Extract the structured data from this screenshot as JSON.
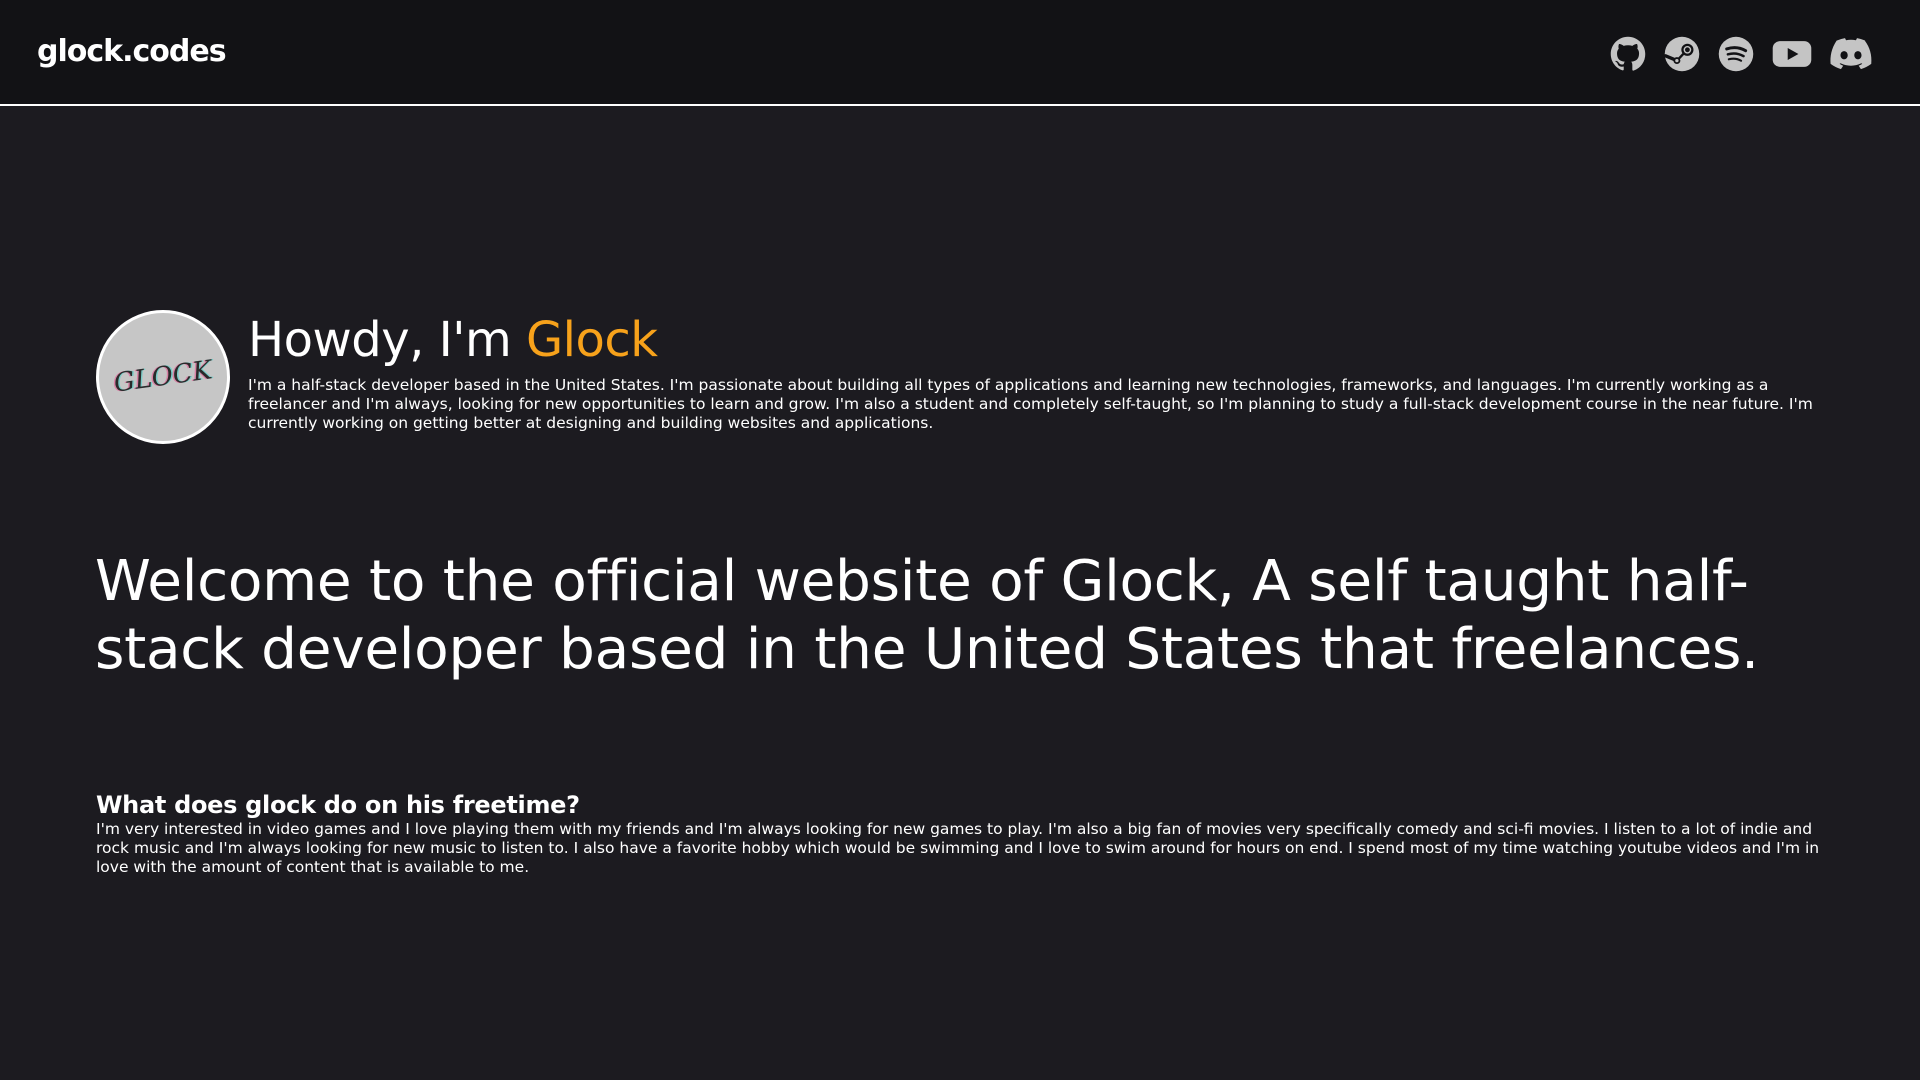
{
  "nav": {
    "brand": "glock.codes",
    "socials": [
      {
        "icon": "github-icon",
        "label": "GitHub"
      },
      {
        "icon": "steam-icon",
        "label": "Steam"
      },
      {
        "icon": "spotify-icon",
        "label": "Spotify"
      },
      {
        "icon": "youtube-icon",
        "label": "YouTube"
      },
      {
        "icon": "discord-icon",
        "label": "Discord"
      }
    ]
  },
  "intro": {
    "avatar_text": "GLOCK",
    "greeting": "Howdy, I'm",
    "name": "Glock",
    "bio": "I'm a half-stack developer based in the United States. I'm passionate about building all types of applications and learning new technologies, frameworks, and languages. I'm currently working as a freelancer and I'm always, looking for new opportunities to learn and grow. I'm also a student and completely self-taught, so I'm planning to study a full-stack development course in the near future. I'm currently working on getting better at designing and building websites and applications."
  },
  "welcome": {
    "text": "Welcome to the official website of Glock, A self taught half-stack developer based in the United States that freelances."
  },
  "freetime": {
    "heading": "What does glock do on his freetime?",
    "body": "I'm very interested in video games and I love playing them with my friends and I'm always looking for new games to play. I'm also a big fan of movies very specifically comedy and sci-fi movies. I listen to a lot of indie and rock music and I'm always looking for new music to listen to. I also have a favorite hobby which would be swimming and I love to swim around for hours on end. I spend most of my time watching youtube videos and I'm in love with the amount of content that is available to me."
  },
  "colors": {
    "background": "#1c1b20",
    "navbar": "#121215",
    "accent": "#f7a21b",
    "icon": "#c4c4c4"
  }
}
